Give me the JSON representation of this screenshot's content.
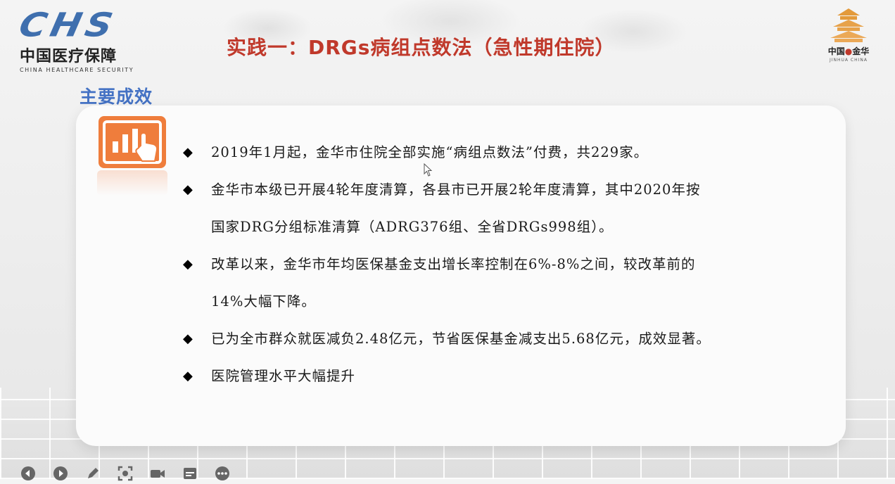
{
  "header": {
    "logo_left": {
      "mark": "CHS",
      "cn": "中国医疗保障",
      "en": "CHINA HEALTHCARE SECURITY"
    },
    "title": "实践一：DRGs病组点数法（急性期住院）",
    "logo_right": {
      "cn_a": "中国",
      "cn_dot": "●",
      "cn_b": "金华",
      "en": "JINHUA CHINA"
    }
  },
  "section": {
    "title": "主要成效",
    "icon": "chart-touch-icon"
  },
  "bullets": [
    {
      "line1": "2019年1月起，金华市住院全部实施“病组点数法”付费，共229家。",
      "line2": ""
    },
    {
      "line1": "金华市本级已开展4轮年度清算，各县市已开展2轮年度清算，其中2020年按",
      "line2": "国家DRG分组标准清算（ADRG376组、全省DRGs998组）。"
    },
    {
      "line1": "改革以来，金华市年均医保基金支出增长率控制在6%-8%之间，较改革前的",
      "line2": "14%大幅下降。"
    },
    {
      "line1": "已为全市群众就医减负2.48亿元，节省医保基金减支出5.68亿元，成效显著。",
      "line2": ""
    },
    {
      "line1": "医院管理水平大幅提升",
      "line2": ""
    }
  ],
  "bullet_marker": "◆",
  "toolbar": {
    "icons": [
      "prev-icon",
      "next-icon",
      "pen-icon",
      "focus-icon",
      "camera-icon",
      "subtitle-icon",
      "more-icon"
    ]
  },
  "colors": {
    "title": "#c0392b",
    "section": "#4472c4",
    "logo_blue": "#3f6fae",
    "icon_orange": "#ef7d3c"
  }
}
